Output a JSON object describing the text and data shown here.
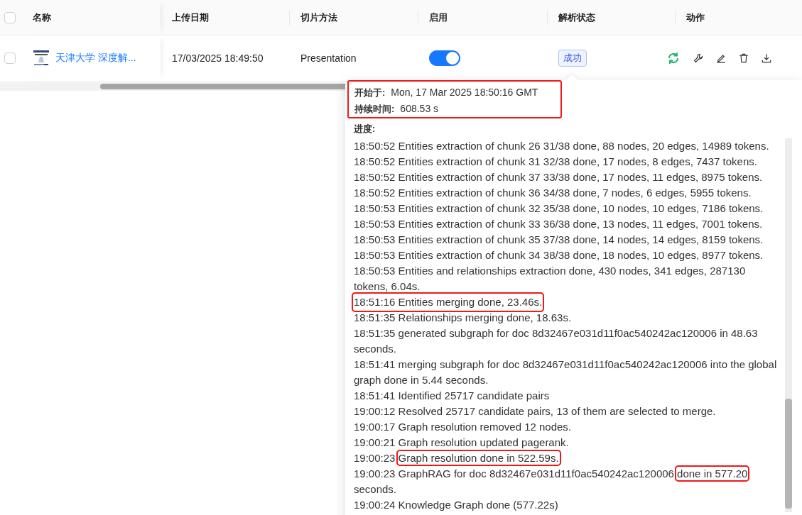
{
  "table": {
    "header_checked": false,
    "columns": [
      {
        "label": "名称"
      },
      {
        "label": "上传日期"
      },
      {
        "label": "切片方法"
      },
      {
        "label": "启用"
      },
      {
        "label": "解析状态"
      },
      {
        "label": "动作"
      }
    ],
    "rows": [
      {
        "checked": false,
        "name": "天津大学 深度解...",
        "upload_date": "17/03/2025 18:49:50",
        "chunk_method": "Presentation",
        "enabled": true,
        "status": "成功"
      }
    ]
  },
  "popover": {
    "fields_highlighted": true,
    "fields": [
      {
        "label": "开始于:",
        "value": "Mon, 17 Mar 2025 18:50:16 GMT"
      },
      {
        "label": "持续时间:",
        "value": "608.53 s"
      }
    ],
    "progress_label": "进度:",
    "log": [
      {
        "text": "18:50:52 Entities extraction of chunk 26 31/38 done, 88 nodes, 20 edges, 14989 tokens.",
        "highlighted": false
      },
      {
        "text": "18:50:52 Entities extraction of chunk 31 32/38 done, 17 nodes, 8 edges, 7437 tokens.",
        "highlighted": false
      },
      {
        "text": "18:50:52 Entities extraction of chunk 37 33/38 done, 17 nodes, 11 edges, 8975 tokens.",
        "highlighted": false
      },
      {
        "text": "18:50:52 Entities extraction of chunk 36 34/38 done, 7 nodes, 6 edges, 5955 tokens.",
        "highlighted": false
      },
      {
        "text": "18:50:53 Entities extraction of chunk 32 35/38 done, 10 nodes, 10 edges, 7186 tokens.",
        "highlighted": false
      },
      {
        "text": "18:50:53 Entities extraction of chunk 33 36/38 done, 13 nodes, 11 edges, 7001 tokens.",
        "highlighted": false
      },
      {
        "text": "18:50:53 Entities extraction of chunk 35 37/38 done, 14 nodes, 14 edges, 8159 tokens.",
        "highlighted": false
      },
      {
        "text": "18:50:53 Entities extraction of chunk 34 38/38 done, 18 nodes, 10 edges, 8977 tokens.",
        "highlighted": false
      },
      {
        "text": "18:50:53 Entities and relationships extraction done, 430 nodes, 341 edges, 287130 tokens, 6.04s.",
        "highlighted": false
      },
      {
        "text": "18:51:16 Entities merging done, 23.46s.",
        "highlighted": true
      },
      {
        "text": "18:51:35 Relationships merging done, 18.63s.",
        "highlighted": false
      },
      {
        "text": "18:51:35 generated subgraph for doc 8d32467e031d11f0ac540242ac120006 in 48.63 seconds.",
        "highlighted": false
      },
      {
        "text": "18:51:41 merging subgraph for doc 8d32467e031d11f0ac540242ac120006 into the global graph done in 5.44 seconds.",
        "highlighted": false
      },
      {
        "text": "18:51:41 Identified 25717 candidate pairs",
        "highlighted": false
      },
      {
        "text": "19:00:12 Resolved 25717 candidate pairs, 13 of them are selected to merge.",
        "highlighted": false
      },
      {
        "text": "19:00:17 Graph resolution removed 12 nodes.",
        "highlighted": false
      },
      {
        "text": "19:00:21 Graph resolution updated pagerank.",
        "highlighted": false
      },
      {
        "parts": [
          {
            "text": "19:00:23 ",
            "highlighted": false
          },
          {
            "text": "Graph resolution done in 522.59s.",
            "highlighted": true
          }
        ]
      },
      {
        "parts": [
          {
            "text": "19:00:23 GraphRAG for doc 8d32467e031d11f0ac540242ac120006 ",
            "highlighted": false
          },
          {
            "text": "done in 577.20",
            "highlighted": true
          },
          {
            "text": " seconds.",
            "highlighted": false
          }
        ]
      },
      {
        "text": "19:00:24 Knowledge Graph done (577.22s)",
        "highlighted": false
      }
    ]
  }
}
